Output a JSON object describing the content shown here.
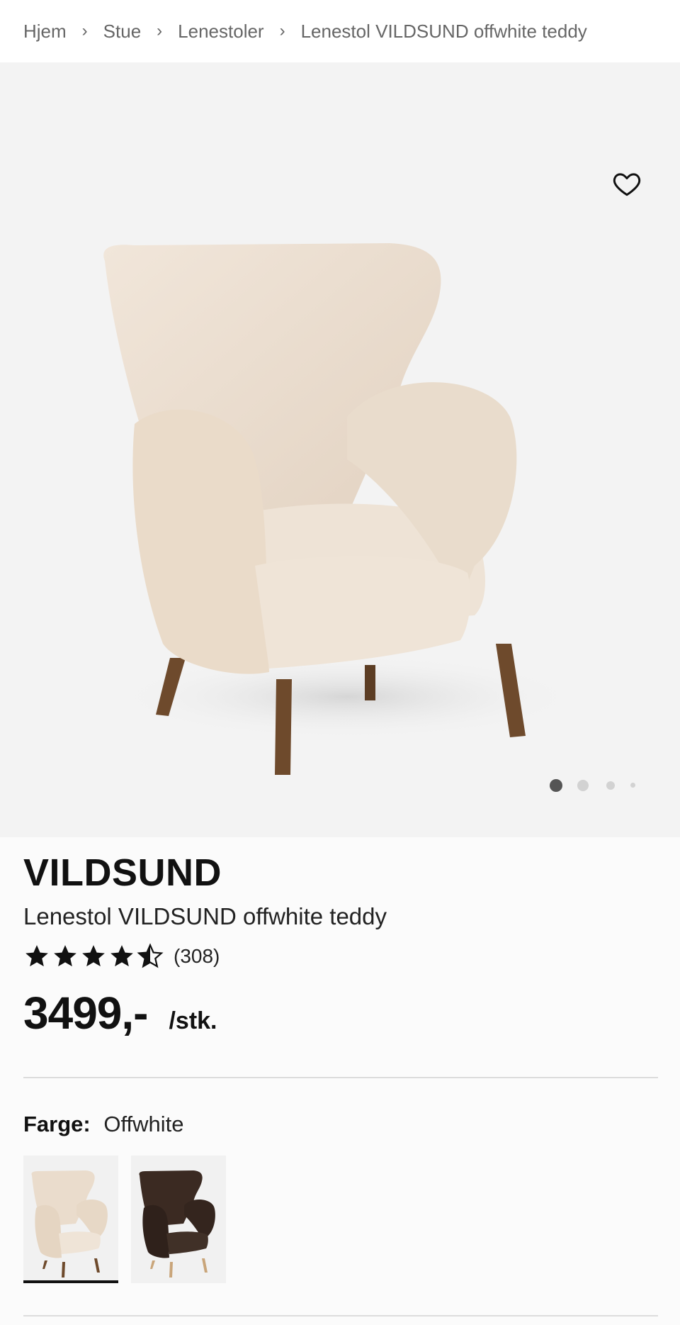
{
  "breadcrumb": {
    "items": [
      "Hjem",
      "Stue",
      "Lenestoler",
      "Lenestol VILDSUND offwhite teddy"
    ]
  },
  "gallery": {
    "favorite_icon": "heart-outline-icon",
    "dots_count": 4,
    "active_dot": 0
  },
  "product": {
    "brand": "VILDSUND",
    "title": "Lenestol VILDSUND offwhite teddy",
    "rating_value": 4.5,
    "rating_count": "(308)",
    "price": "3499,-",
    "price_unit": "/stk."
  },
  "color": {
    "label": "Farge:",
    "selected": "Offwhite",
    "swatches": [
      "offwhite",
      "brown"
    ]
  },
  "colors": {
    "gallery_bg": "#f3f3f3",
    "chair_offwhite": "#eadccc",
    "chair_brown": "#3b2a22",
    "wood": "#6e4a2c"
  }
}
